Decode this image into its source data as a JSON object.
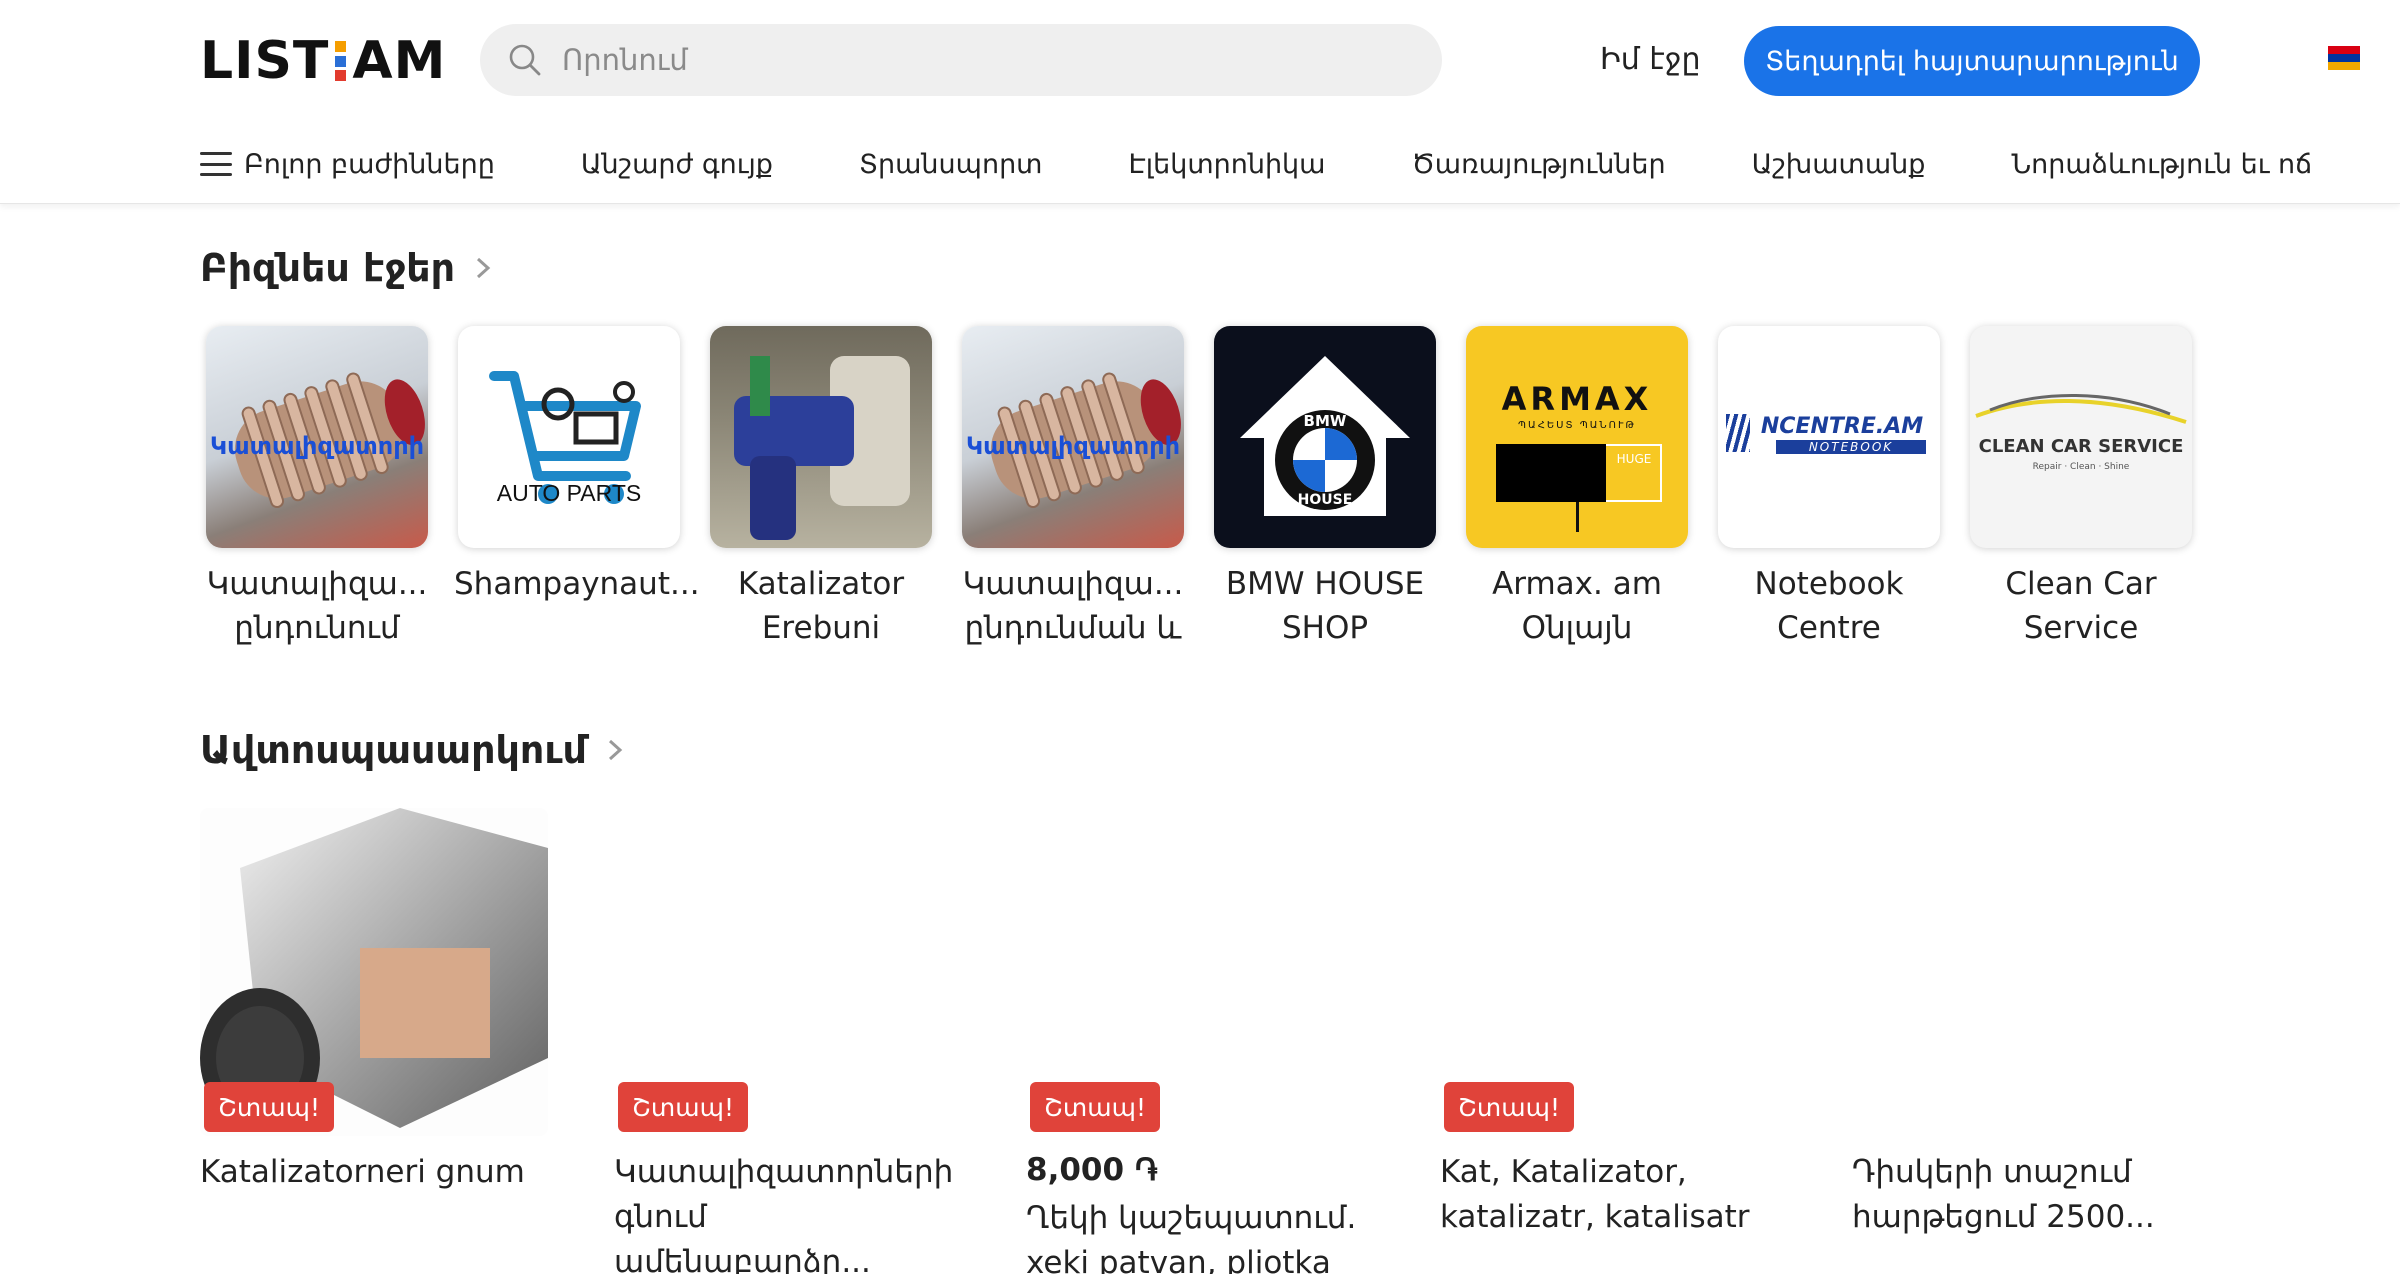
{
  "header": {
    "logo_left": "LIST",
    "logo_right": "AM",
    "search_placeholder": "Որոնում",
    "my_page": "Իմ էջը",
    "post_button": "Տեղադրել հայտարարություն"
  },
  "nav": {
    "all_categories": "Բոլոր բաժինները",
    "items": [
      "Անշարժ գույք",
      "Տրանսպորտ",
      "Էլեկտրոնիկա",
      "Ծառայություններ",
      "Աշխատանք",
      "Նորաձևություն եւ ոճ"
    ]
  },
  "business": {
    "title": "Բիզնես էջեր",
    "pages": [
      {
        "line1": "Կատալիզա...",
        "line2": "ընդունում"
      },
      {
        "line1": "Shampaynaut...",
        "line2": ""
      },
      {
        "line1": "Katalizator",
        "line2": "Erebuni"
      },
      {
        "line1": "Կատալիզա...",
        "line2": "ընդունման և"
      },
      {
        "line1": "BMW HOUSE",
        "line2": "SHOP"
      },
      {
        "line1": "Armax. am",
        "line2": "Օնլայն"
      },
      {
        "line1": "Notebook",
        "line2": "Centre"
      },
      {
        "line1": "Clean Car",
        "line2": "Service"
      }
    ],
    "logo_texts": {
      "katalizator_overlay": "Կատալիզատորի",
      "auto_parts": "AUTO PARTS",
      "bmw_top": "BMW",
      "bmw_bottom": "HOUSE",
      "armax": "ARMAX",
      "armax_sub": "ՊԱՀԵՍՏ ՊԱՆՈՒԹ",
      "armax_huge": "HUGE",
      "ncentre": "NCENTRE.AM",
      "notebook": "NOTEBOOK",
      "clean_car": "CLEAN CAR SERVICE",
      "clean_car_tag": "Repair · Clean · Shine"
    }
  },
  "ads": {
    "title": "Ավտոսպասարկում",
    "badge": "Շտապ!",
    "items": [
      {
        "line1": "Katalizatorneri gnum",
        "line2": "",
        "price": ""
      },
      {
        "line1": "Կատալիզատորների",
        "line2": "գնում ամենաբարձր...",
        "price": ""
      },
      {
        "line1": "Ղեկի կաշեպատում.",
        "line2": "xeki patvan, pliotka",
        "price": "8,000 ֏"
      },
      {
        "line1": "Kat, Katalizator,",
        "line2": "katalizatr, katalisatr",
        "price": ""
      },
      {
        "line1": "Դիսկերի տաշում",
        "line2": "հարթեցում 2500...",
        "price": ""
      }
    ]
  },
  "colors": {
    "accent": "#1a73e8",
    "badge": "#e0433a",
    "flag": [
      "#d90012",
      "#0033a0",
      "#f2a800"
    ]
  }
}
